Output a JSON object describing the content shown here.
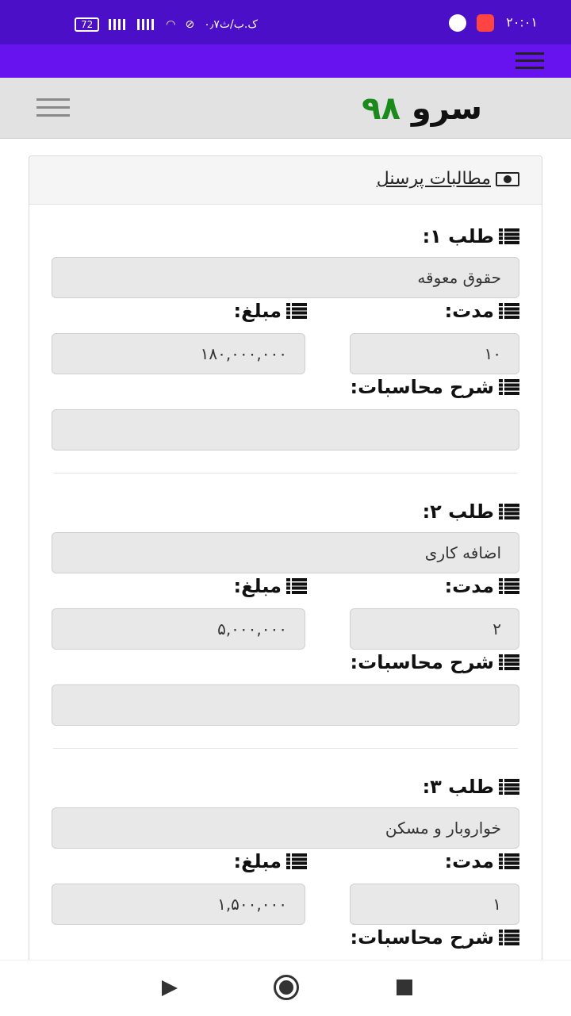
{
  "status_bar": {
    "time": "۲۰:۰۱",
    "network_speed": "۰٫۷ک.ب/ث",
    "battery": "72"
  },
  "app": {
    "logo_word": "سرو",
    "logo_number": "۹۸"
  },
  "panel": {
    "title": "مطالبات پرسنل"
  },
  "labels": {
    "request_prefix": "طلب",
    "duration": "مدت:",
    "amount": "مبلغ:",
    "calc_desc": "شرح محاسبات:"
  },
  "requests": [
    {
      "label": "طلب ۱:",
      "title": "حقوق معوقه",
      "duration": "۱۰",
      "amount": "۱۸۰,۰۰۰,۰۰۰",
      "description": ""
    },
    {
      "label": "طلب ۲:",
      "title": "اضافه کاری",
      "duration": "۲",
      "amount": "۵,۰۰۰,۰۰۰",
      "description": ""
    },
    {
      "label": "طلب ۳:",
      "title": "خواروبار و مسکن",
      "duration": "۱",
      "amount": "۱,۵۰۰,۰۰۰",
      "description": ""
    }
  ]
}
